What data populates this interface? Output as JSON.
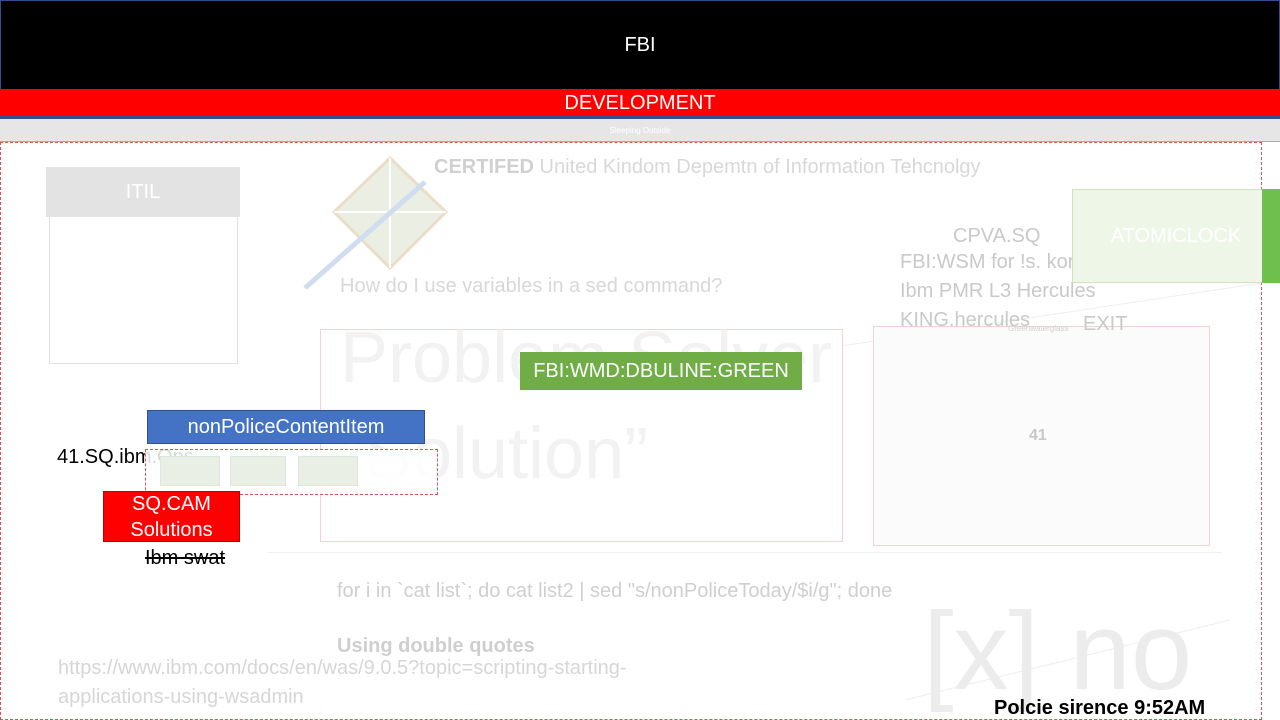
{
  "header": {
    "title": "FBI"
  },
  "environment_bar": {
    "label": "DEVELOPMENT"
  },
  "sub_bar": {
    "label": "Sleeping Outside"
  },
  "itil": {
    "title": "ITIL"
  },
  "certification": {
    "bold": "CERTIFED",
    "rest": " United Kindom Depemtn of Information Tehcnolgy"
  },
  "question": "How do I use variables in a sed command?",
  "problem": {
    "text": "Problem Solver “Solution”"
  },
  "green_badge": "FBI:WMD:DBULINE:GREEN",
  "right_panel": {
    "cpva": "CPVA.SQ",
    "lines": [
      "FBI:WSM for !s. korea",
      "Ibm PMR L3 Hercules",
      "KING.hercules"
    ],
    "tiny": "Greenwaterglass",
    "exit": "EXIT",
    "number": "41"
  },
  "atomic_clock": "ATOMICLOCK",
  "non_police_button": "nonPoliceContentItem",
  "sq_ibm": "41.SQ.ibm.Ops",
  "sqcam_button": "SQ.CAM Solutions",
  "ibm_swat": "Ibm swat",
  "code": {
    "line": "for i in `cat list`; do cat list2 | sed \"s/nonPoliceToday/$i/g\"; done",
    "note": "Using double quotes"
  },
  "url": "https://www.ibm.com/docs/en/was/9.0.5?topic=scripting-starting-applications-using-wsadmin",
  "watermark": "[x] no",
  "clock": "Polcie sirence 9:52AM",
  "colors": {
    "brand_red": "#ff0000",
    "badge_green": "#70ad47",
    "button_blue": "#4472c4",
    "header_black": "#000000"
  }
}
